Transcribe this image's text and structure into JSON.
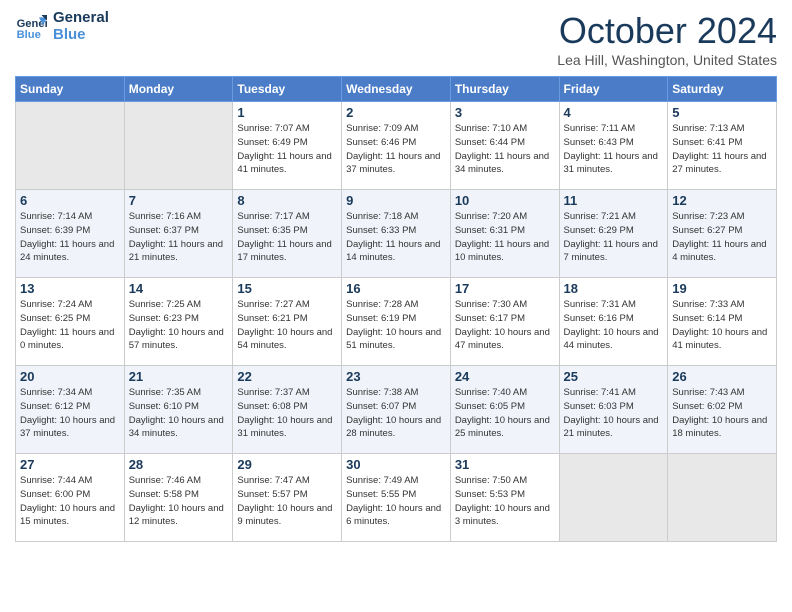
{
  "header": {
    "logo_line1": "General",
    "logo_line2": "Blue",
    "month_title": "October 2024",
    "location": "Lea Hill, Washington, United States"
  },
  "weekdays": [
    "Sunday",
    "Monday",
    "Tuesday",
    "Wednesday",
    "Thursday",
    "Friday",
    "Saturday"
  ],
  "weeks": [
    [
      {
        "day": "",
        "info": ""
      },
      {
        "day": "",
        "info": ""
      },
      {
        "day": "1",
        "info": "Sunrise: 7:07 AM\nSunset: 6:49 PM\nDaylight: 11 hours and 41 minutes."
      },
      {
        "day": "2",
        "info": "Sunrise: 7:09 AM\nSunset: 6:46 PM\nDaylight: 11 hours and 37 minutes."
      },
      {
        "day": "3",
        "info": "Sunrise: 7:10 AM\nSunset: 6:44 PM\nDaylight: 11 hours and 34 minutes."
      },
      {
        "day": "4",
        "info": "Sunrise: 7:11 AM\nSunset: 6:43 PM\nDaylight: 11 hours and 31 minutes."
      },
      {
        "day": "5",
        "info": "Sunrise: 7:13 AM\nSunset: 6:41 PM\nDaylight: 11 hours and 27 minutes."
      }
    ],
    [
      {
        "day": "6",
        "info": "Sunrise: 7:14 AM\nSunset: 6:39 PM\nDaylight: 11 hours and 24 minutes."
      },
      {
        "day": "7",
        "info": "Sunrise: 7:16 AM\nSunset: 6:37 PM\nDaylight: 11 hours and 21 minutes."
      },
      {
        "day": "8",
        "info": "Sunrise: 7:17 AM\nSunset: 6:35 PM\nDaylight: 11 hours and 17 minutes."
      },
      {
        "day": "9",
        "info": "Sunrise: 7:18 AM\nSunset: 6:33 PM\nDaylight: 11 hours and 14 minutes."
      },
      {
        "day": "10",
        "info": "Sunrise: 7:20 AM\nSunset: 6:31 PM\nDaylight: 11 hours and 10 minutes."
      },
      {
        "day": "11",
        "info": "Sunrise: 7:21 AM\nSunset: 6:29 PM\nDaylight: 11 hours and 7 minutes."
      },
      {
        "day": "12",
        "info": "Sunrise: 7:23 AM\nSunset: 6:27 PM\nDaylight: 11 hours and 4 minutes."
      }
    ],
    [
      {
        "day": "13",
        "info": "Sunrise: 7:24 AM\nSunset: 6:25 PM\nDaylight: 11 hours and 0 minutes."
      },
      {
        "day": "14",
        "info": "Sunrise: 7:25 AM\nSunset: 6:23 PM\nDaylight: 10 hours and 57 minutes."
      },
      {
        "day": "15",
        "info": "Sunrise: 7:27 AM\nSunset: 6:21 PM\nDaylight: 10 hours and 54 minutes."
      },
      {
        "day": "16",
        "info": "Sunrise: 7:28 AM\nSunset: 6:19 PM\nDaylight: 10 hours and 51 minutes."
      },
      {
        "day": "17",
        "info": "Sunrise: 7:30 AM\nSunset: 6:17 PM\nDaylight: 10 hours and 47 minutes."
      },
      {
        "day": "18",
        "info": "Sunrise: 7:31 AM\nSunset: 6:16 PM\nDaylight: 10 hours and 44 minutes."
      },
      {
        "day": "19",
        "info": "Sunrise: 7:33 AM\nSunset: 6:14 PM\nDaylight: 10 hours and 41 minutes."
      }
    ],
    [
      {
        "day": "20",
        "info": "Sunrise: 7:34 AM\nSunset: 6:12 PM\nDaylight: 10 hours and 37 minutes."
      },
      {
        "day": "21",
        "info": "Sunrise: 7:35 AM\nSunset: 6:10 PM\nDaylight: 10 hours and 34 minutes."
      },
      {
        "day": "22",
        "info": "Sunrise: 7:37 AM\nSunset: 6:08 PM\nDaylight: 10 hours and 31 minutes."
      },
      {
        "day": "23",
        "info": "Sunrise: 7:38 AM\nSunset: 6:07 PM\nDaylight: 10 hours and 28 minutes."
      },
      {
        "day": "24",
        "info": "Sunrise: 7:40 AM\nSunset: 6:05 PM\nDaylight: 10 hours and 25 minutes."
      },
      {
        "day": "25",
        "info": "Sunrise: 7:41 AM\nSunset: 6:03 PM\nDaylight: 10 hours and 21 minutes."
      },
      {
        "day": "26",
        "info": "Sunrise: 7:43 AM\nSunset: 6:02 PM\nDaylight: 10 hours and 18 minutes."
      }
    ],
    [
      {
        "day": "27",
        "info": "Sunrise: 7:44 AM\nSunset: 6:00 PM\nDaylight: 10 hours and 15 minutes."
      },
      {
        "day": "28",
        "info": "Sunrise: 7:46 AM\nSunset: 5:58 PM\nDaylight: 10 hours and 12 minutes."
      },
      {
        "day": "29",
        "info": "Sunrise: 7:47 AM\nSunset: 5:57 PM\nDaylight: 10 hours and 9 minutes."
      },
      {
        "day": "30",
        "info": "Sunrise: 7:49 AM\nSunset: 5:55 PM\nDaylight: 10 hours and 6 minutes."
      },
      {
        "day": "31",
        "info": "Sunrise: 7:50 AM\nSunset: 5:53 PM\nDaylight: 10 hours and 3 minutes."
      },
      {
        "day": "",
        "info": ""
      },
      {
        "day": "",
        "info": ""
      }
    ]
  ]
}
